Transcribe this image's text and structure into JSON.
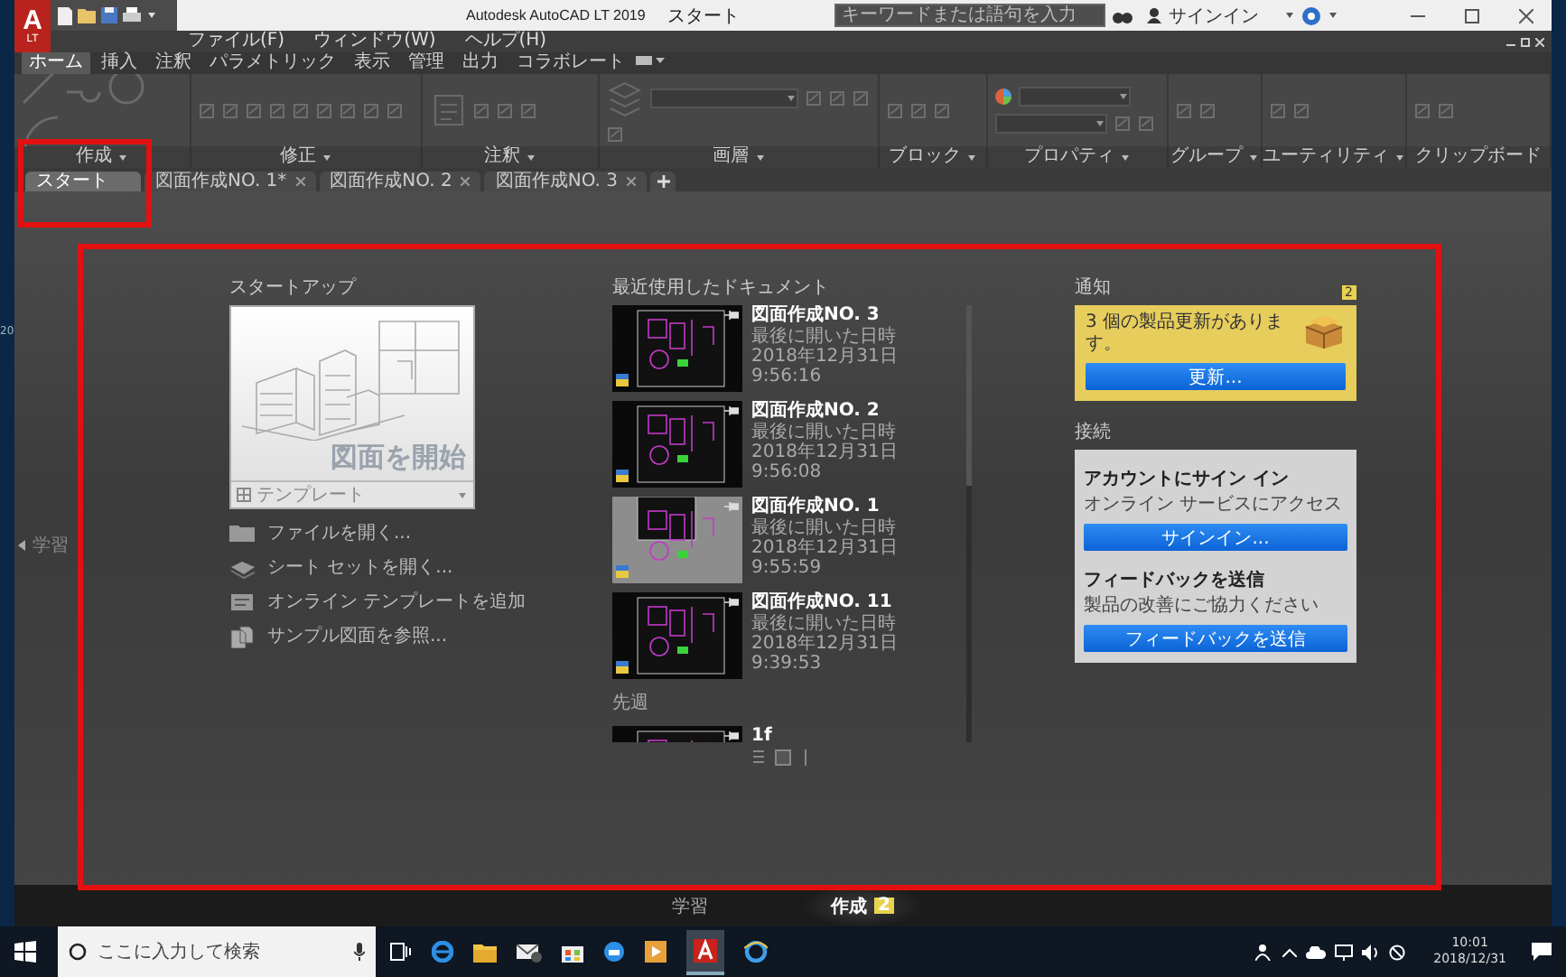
{
  "app_logo": {
    "letter": "A",
    "edition": "LT"
  },
  "title_bar": {
    "title": "Autodesk AutoCAD LT 2019",
    "document": "スタート",
    "search": {
      "placeholder": "キーワードまたは語句を入力"
    },
    "sign_in": "サインイン"
  },
  "menu_bar": [
    "ファイル(F)",
    "ウィンドウ(W)",
    "ヘルプ(H)"
  ],
  "ribbon_tabs": [
    {
      "label": "ホーム",
      "selected": true
    },
    {
      "label": "挿入",
      "selected": false
    },
    {
      "label": "注釈",
      "selected": false
    },
    {
      "label": "パラメトリック",
      "selected": false
    },
    {
      "label": "表示",
      "selected": false
    },
    {
      "label": "管理",
      "selected": false
    },
    {
      "label": "出力",
      "selected": false
    },
    {
      "label": "コラボレート",
      "selected": false
    }
  ],
  "ribbon_panels": [
    "作成",
    "修正",
    "注釈",
    "画層",
    "ブロック",
    "プロパティ",
    "グループ",
    "ユーティリティ",
    "クリップボード"
  ],
  "file_tabs": [
    {
      "label": "スタート",
      "selected": true
    },
    {
      "label": "図面作成NO. 1*",
      "selected": false
    },
    {
      "label": "図面作成NO. 2",
      "selected": false
    },
    {
      "label": "図面作成NO. 3",
      "selected": false
    }
  ],
  "desktop_edge_text": "20",
  "side_panel_label": "学習",
  "startup": {
    "heading": "スタートアップ",
    "start_label": "図面を開始",
    "template": "テンプレート",
    "links": [
      "ファイルを開く...",
      "シート セットを開く...",
      "オンライン テンプレートを追加",
      "サンプル図面を参照..."
    ]
  },
  "recent": {
    "heading": "最近使用したドキュメント",
    "documents": [
      {
        "name": "図面作成NO. 3",
        "opened": "最後に開いた日時 2018年12月31日",
        "time": "9:56:16"
      },
      {
        "name": "図面作成NO. 2",
        "opened": "最後に開いた日時 2018年12月31日",
        "time": "9:56:08"
      },
      {
        "name": "図面作成NO. 1",
        "opened": "最後に開いた日時 2018年12月31日",
        "time": "9:55:59"
      },
      {
        "name": "図面作成NO. 11",
        "opened": "最後に開いた日時 2018年12月31日",
        "time": "9:39:53"
      }
    ],
    "group_label": "先週",
    "partial_document": {
      "name": "1f"
    }
  },
  "notifications": {
    "heading": "通知",
    "count": "2",
    "message": "3 個の製品更新があります。",
    "button": "更新..."
  },
  "connect": {
    "heading": "接続",
    "sections": [
      {
        "title": "アカウントにサイン イン",
        "text": "オンライン サービスにアクセス",
        "button": "サインイン..."
      },
      {
        "title": "フィードバックを送信",
        "text": "製品の改善にご協力ください",
        "button": "フィードバックを送信"
      }
    ]
  },
  "bottom_tabs": [
    {
      "label": "学習",
      "selected": false
    },
    {
      "label": "作成",
      "selected": true,
      "badge": "2"
    }
  ],
  "taskbar": {
    "search_placeholder": "ここに入力して検索",
    "time": "10:01",
    "date": "2018/12/31"
  }
}
